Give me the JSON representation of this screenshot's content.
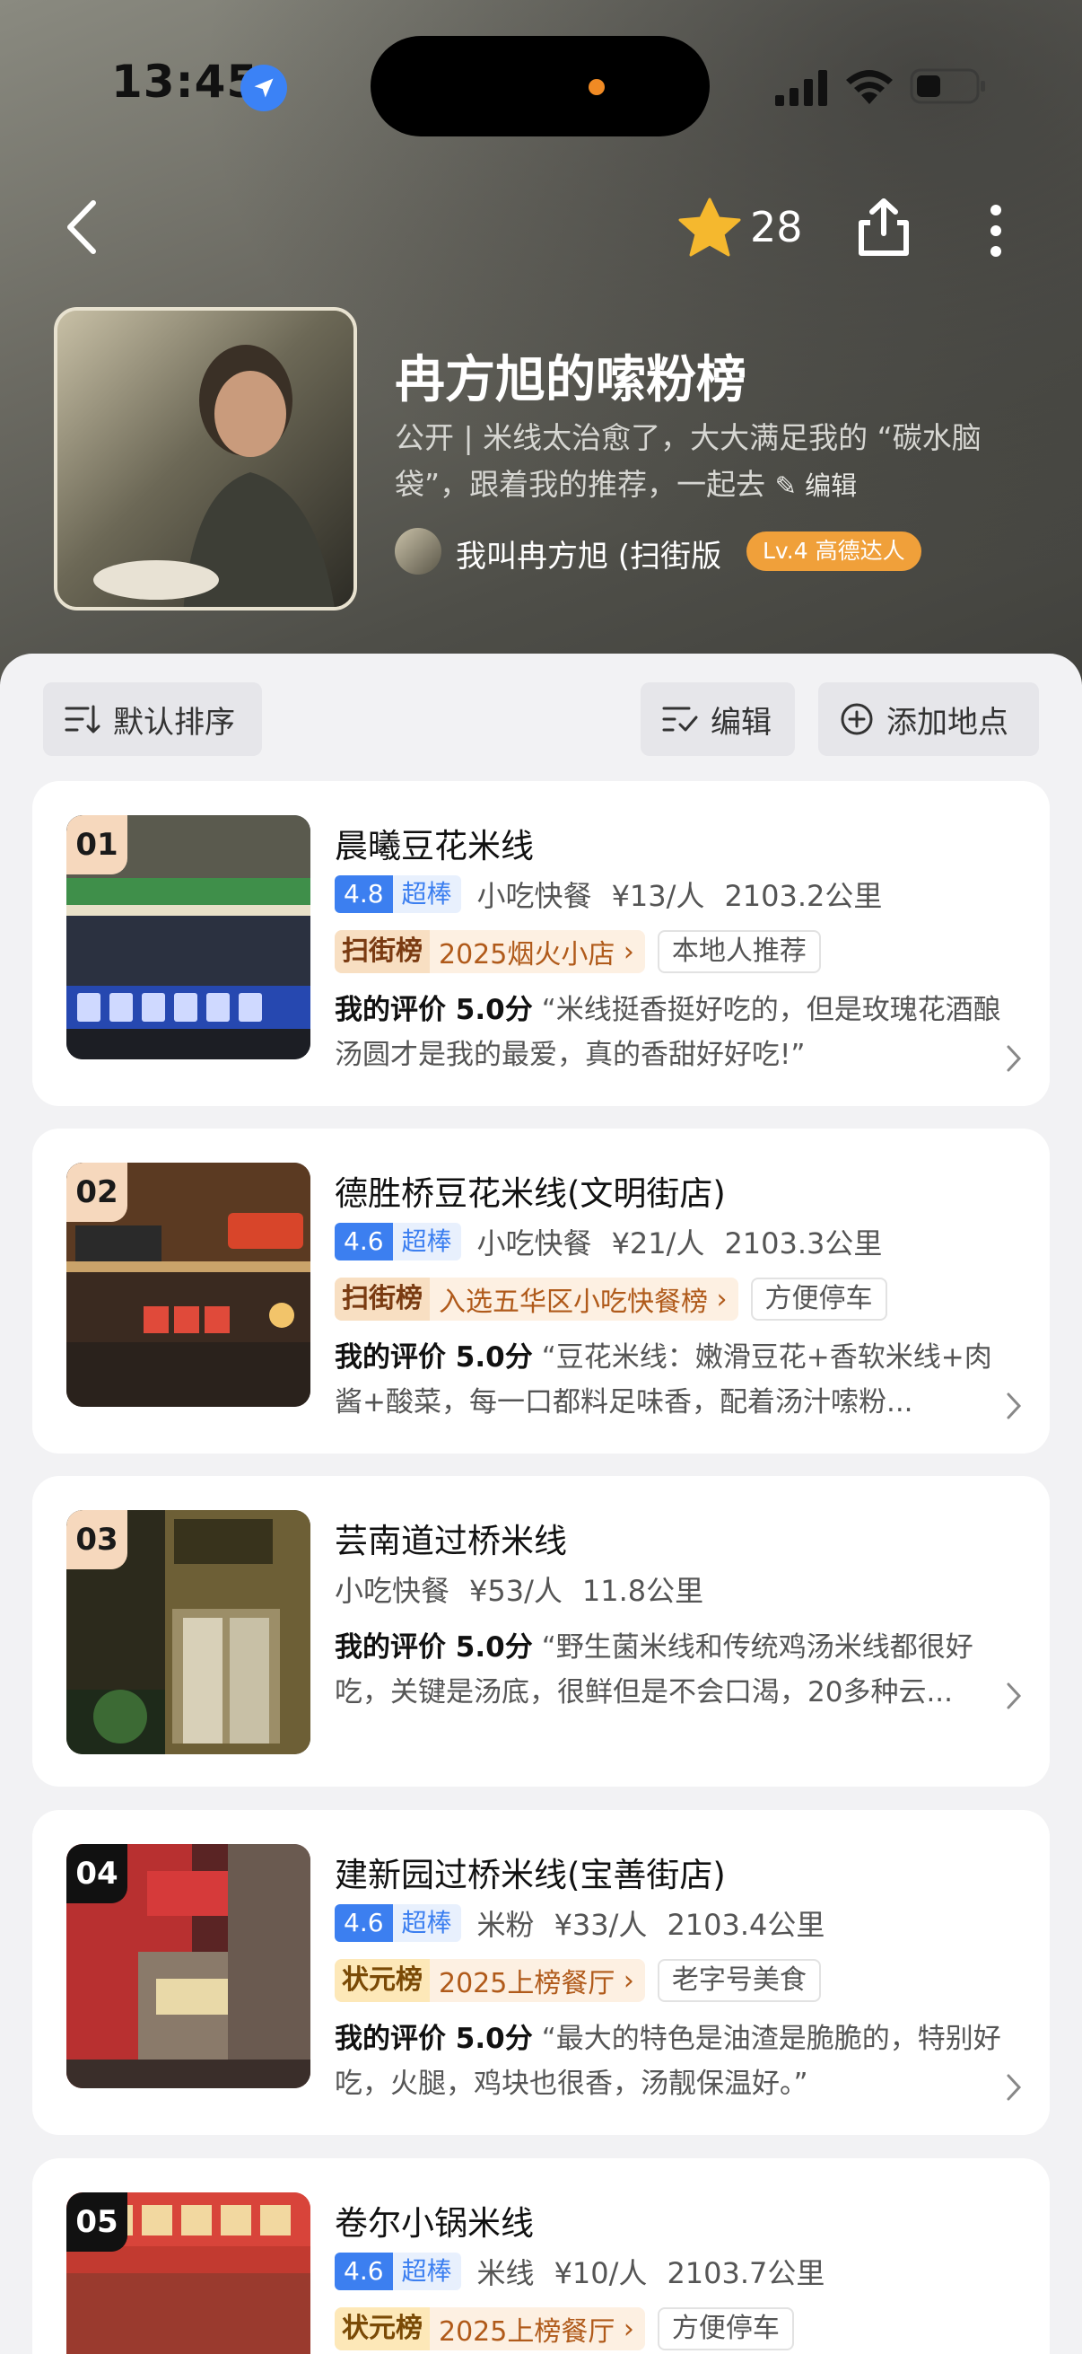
{
  "status_bar": {
    "time": "13:45"
  },
  "header": {
    "star_count": "28"
  },
  "list": {
    "title": "冉方旭的嗦粉榜",
    "visibility": "公开",
    "description": "米线太治愈了，大大满足我的 “碳水脑袋”，跟着我的推荐，一起去",
    "edit_label": "编辑",
    "author": "我叫冉方旭 (扫街版",
    "author_level": "Lv.4 高德达人"
  },
  "toolbar": {
    "sort_label": "默认排序",
    "edit_label": "编辑",
    "add_label": "添加地点"
  },
  "places": [
    {
      "rank": "01",
      "name": "晨曦豆花米线",
      "score": "4.8",
      "score_word": "超棒",
      "category": "小吃快餐",
      "price": "¥13/人",
      "distance": "2103.2公里",
      "rank_logo": "扫街榜",
      "rank_text": "2025烟火小店",
      "plain_tag": "本地人推荐",
      "rating_label": "我的评价 5.0分",
      "review": "“米线挺香挺好吃的，但是玫瑰花酒酿汤圆才是我的最爱，真的香甜好好吃!”"
    },
    {
      "rank": "02",
      "name": "德胜桥豆花米线(文明街店)",
      "score": "4.6",
      "score_word": "超棒",
      "category": "小吃快餐",
      "price": "¥21/人",
      "distance": "2103.3公里",
      "rank_logo": "扫街榜",
      "rank_text": "入选五华区小吃快餐榜",
      "plain_tag": "方便停车",
      "rating_label": "我的评价 5.0分",
      "review": "“豆花米线：嫩滑豆花+香软米线+肉酱+酸菜，每一口都料足味香，配着汤汁嗦粉..."
    },
    {
      "rank": "03",
      "name": "芸南道过桥米线",
      "category": "小吃快餐",
      "price": "¥53/人",
      "distance": "11.8公里",
      "rating_label": "我的评价 5.0分",
      "review": "“野生菌米线和传统鸡汤米线都很好吃，关键是汤底，很鲜但是不会口渴，20多种云..."
    },
    {
      "rank": "04",
      "name": "建新园过桥米线(宝善街店)",
      "score": "4.6",
      "score_word": "超棒",
      "category": "米粉",
      "price": "¥33/人",
      "distance": "2103.4公里",
      "rank_logo": "状元榜",
      "rank_text": "2025上榜餐厅",
      "plain_tag": "老字号美食",
      "rating_label": "我的评价 5.0分",
      "review": "“最大的特色是油渣是脆脆的，特别好吃，火腿，鸡块也很香，汤靓保温好。”"
    },
    {
      "rank": "05",
      "name": "卷尔小锅米线",
      "score": "4.6",
      "score_word": "超棒",
      "category": "米线",
      "price": "¥10/人",
      "distance": "2103.7公里",
      "rank_logo": "状元榜",
      "rank_text": "2025上榜餐厅",
      "plain_tag": "方便停车"
    }
  ],
  "colors": {
    "score_blue": "#3c7ff0",
    "level_orange": "#f0a03a",
    "star_gold": "#f5b82e"
  }
}
